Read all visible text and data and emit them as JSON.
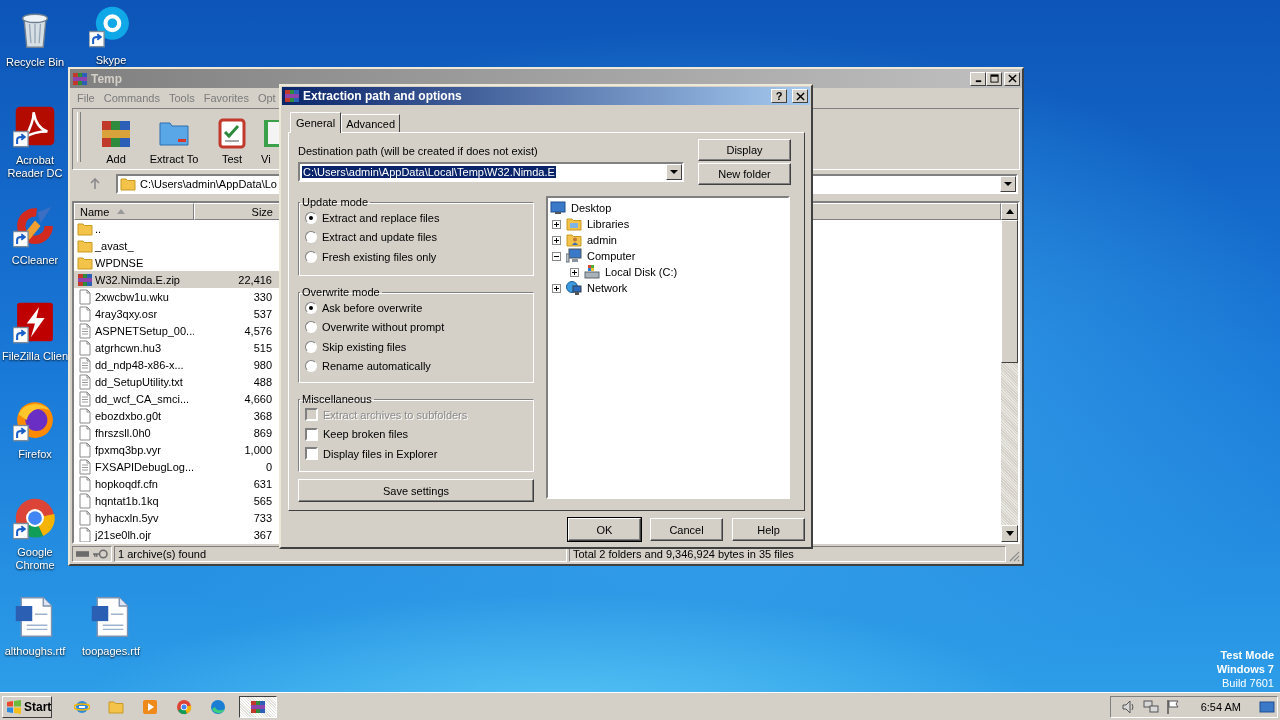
{
  "desktop_icons": [
    {
      "label": "Recycle Bin",
      "kind": "trash",
      "shortcut": false
    },
    {
      "label": "Skype",
      "kind": "skype",
      "shortcut": true
    },
    {
      "label": "Acrobat Reader DC",
      "kind": "acrobat",
      "shortcut": true
    },
    {
      "label": "CCleaner",
      "kind": "ccleaner",
      "shortcut": true
    },
    {
      "label": "FileZilla Clien",
      "kind": "filezilla",
      "shortcut": true
    },
    {
      "label": "Firefox",
      "kind": "firefox",
      "shortcut": true
    },
    {
      "label": "Google Chrome",
      "kind": "chrome",
      "shortcut": true
    },
    {
      "label": "althoughs.rtf",
      "kind": "worddoc",
      "shortcut": false
    },
    {
      "label": "toopages.rtf",
      "kind": "worddoc",
      "shortcut": false
    }
  ],
  "winrar": {
    "title": "Temp",
    "menu": [
      "File",
      "Commands",
      "Tools",
      "Favorites",
      "Opt"
    ],
    "toolbar": [
      {
        "label": "Add",
        "kind": "add"
      },
      {
        "label": "Extract To",
        "kind": "extract"
      },
      {
        "label": "Test",
        "kind": "test"
      },
      {
        "label": "Vi",
        "kind": "view"
      }
    ],
    "address": "C:\\Users\\admin\\AppData\\Lo",
    "columns": [
      "Name",
      "Size"
    ],
    "rows": [
      {
        "name": "..",
        "kind": "folder",
        "selected": false
      },
      {
        "name": "_avast_",
        "kind": "folder",
        "selected": false
      },
      {
        "name": "WPDNSE",
        "kind": "folder",
        "selected": false
      },
      {
        "name": "W32.Nimda.E.zip",
        "size": "22,416",
        "kind": "archive",
        "selected": true
      },
      {
        "name": "2xwcbw1u.wku",
        "size": "330",
        "kind": "file",
        "selected": false
      },
      {
        "name": "4ray3qxy.osr",
        "size": "537",
        "kind": "file",
        "selected": false
      },
      {
        "name": "ASPNETSetup_00...",
        "size": "4,576",
        "kind": "text",
        "selected": false
      },
      {
        "name": "atgrhcwn.hu3",
        "size": "515",
        "kind": "file",
        "selected": false
      },
      {
        "name": "dd_ndp48-x86-x...",
        "size": "980",
        "kind": "text",
        "selected": false
      },
      {
        "name": "dd_SetupUtility.txt",
        "size": "488",
        "kind": "text",
        "selected": false
      },
      {
        "name": "dd_wcf_CA_smci...",
        "size": "4,660",
        "kind": "text",
        "selected": false
      },
      {
        "name": "ebozdxbo.g0t",
        "size": "368",
        "kind": "file",
        "selected": false
      },
      {
        "name": "fhrszsll.0h0",
        "size": "869",
        "kind": "file",
        "selected": false
      },
      {
        "name": "fpxmq3bp.vyr",
        "size": "1,000",
        "kind": "file",
        "selected": false
      },
      {
        "name": "FXSAPIDebugLog...",
        "size": "0",
        "kind": "text",
        "selected": false
      },
      {
        "name": "hopkoqdf.cfn",
        "size": "631",
        "kind": "file",
        "selected": false
      },
      {
        "name": "hqntat1b.1kq",
        "size": "565",
        "kind": "file",
        "selected": false
      },
      {
        "name": "hyhacxln.5yv",
        "size": "733",
        "kind": "file",
        "selected": false
      },
      {
        "name": "j21se0lh.ojr",
        "size": "367",
        "kind": "file",
        "selected": false
      }
    ],
    "status_left": "1 archive(s) found",
    "status_right": "Total 2 folders and 9,346,924 bytes in 35 files"
  },
  "dialog": {
    "title": "Extraction path and options",
    "help_glyph": "?",
    "tabs": [
      {
        "label": "General",
        "selected": true
      },
      {
        "label": "Advanced",
        "selected": false
      }
    ],
    "path_label": "Destination path (will be created if does not exist)",
    "path_value": "C:\\Users\\admin\\AppData\\Local\\Temp\\W32.Nimda.E",
    "side_buttons": [
      "Display",
      "New folder"
    ],
    "groups": [
      {
        "title": "Update mode",
        "kind": "radio",
        "options": [
          {
            "label": "Extract and replace files",
            "selected": true
          },
          {
            "label": "Extract and update files",
            "selected": false
          },
          {
            "label": "Fresh existing files only",
            "selected": false
          }
        ]
      },
      {
        "title": "Overwrite mode",
        "kind": "radio",
        "options": [
          {
            "label": "Ask before overwrite",
            "selected": true
          },
          {
            "label": "Overwrite without prompt",
            "selected": false
          },
          {
            "label": "Skip existing files",
            "selected": false
          },
          {
            "label": "Rename automatically",
            "selected": false
          }
        ]
      },
      {
        "title": "Miscellaneous",
        "kind": "checkbox",
        "options": [
          {
            "label": "Extract archives to subfolders",
            "checked": false,
            "disabled": true
          },
          {
            "label": "Keep broken files",
            "checked": false,
            "disabled": false
          },
          {
            "label": "Display files in Explorer",
            "checked": false,
            "disabled": false
          }
        ]
      }
    ],
    "save_button": "Save settings",
    "tree": {
      "label": "Desktop",
      "kind": "desktop",
      "children": [
        {
          "label": "Libraries",
          "kind": "libraries",
          "expanded": false
        },
        {
          "label": "admin",
          "kind": "user",
          "expanded": false
        },
        {
          "label": "Computer",
          "kind": "computer",
          "expanded": true,
          "children": [
            {
              "label": "Local Disk (C:)",
              "kind": "disk",
              "expanded": false
            }
          ]
        },
        {
          "label": "Network",
          "kind": "network",
          "expanded": false
        }
      ]
    },
    "buttons": [
      "OK",
      "Cancel",
      "Help"
    ]
  },
  "system_info": [
    "Test Mode",
    "Windows 7",
    "Build 7601"
  ],
  "taskbar": {
    "start": "Start",
    "apps": [
      {
        "kind": "ie",
        "selected": false
      },
      {
        "kind": "explorer",
        "selected": false
      },
      {
        "kind": "media",
        "selected": false
      },
      {
        "kind": "chrome",
        "selected": false
      },
      {
        "kind": "edge",
        "selected": false
      },
      {
        "kind": "archive",
        "selected": true
      }
    ],
    "clock": "6:54 AM"
  }
}
